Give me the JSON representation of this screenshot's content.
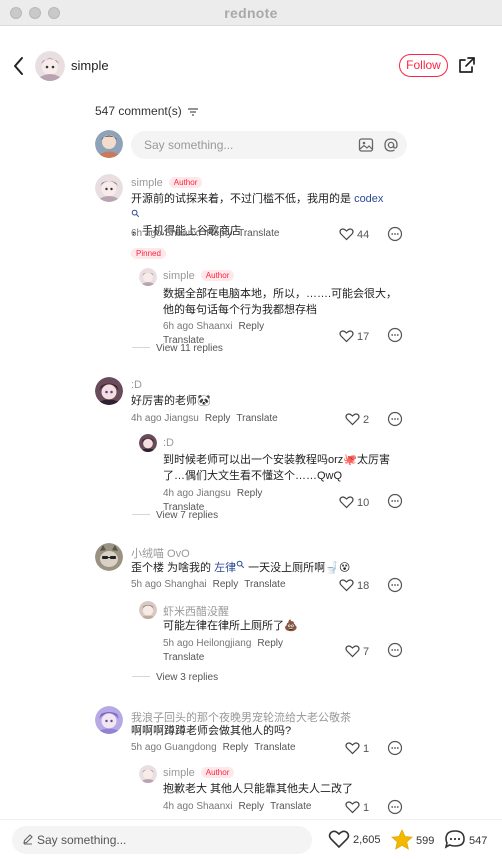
{
  "window": {
    "title": "rednote"
  },
  "header": {
    "author_name": "simple",
    "follow_label": "Follow"
  },
  "comments_header": {
    "count_label": "547 comment(s)"
  },
  "composer": {
    "placeholder": "Say something..."
  },
  "author_tag": "Author",
  "pinned_label": "Pinned",
  "reply_label": "Reply",
  "translate_label": "Translate",
  "threads": [
    {
      "name": "simple",
      "is_author": true,
      "pinned": true,
      "text_before": "开源前的试探来着，不过门槛不低，我用的是 ",
      "link": "codex",
      "text_after": "，手机得能上谷歌商店",
      "time": "6h ago Shaanxi",
      "likes": "44",
      "reply": {
        "name": "simple",
        "is_author": true,
        "text": "数据全部在电脑本地，所以，…….可能会很大，他的每句话每个行为我都想存档",
        "time": "6h ago Shaanxi",
        "likes": "17"
      },
      "view_replies": "View 11 replies"
    },
    {
      "name": ":D",
      "text": "好厉害的老师🐼",
      "time": "4h ago Jiangsu",
      "likes": "2",
      "reply": {
        "name": ":D",
        "text": "到时候老师可以出一个安装教程吗orz🐙太厉害了…偶们大文生看不懂这个……QwQ",
        "time": "4h ago Jiangsu",
        "likes": "10"
      },
      "view_replies": "View 7 replies"
    },
    {
      "name": "小绒喵 OvO",
      "text_before": "歪个楼 为啥我的 ",
      "link": "左律",
      "text_after": " 一天没上厕所啊🚽😵",
      "time": "5h ago Shanghai",
      "likes": "18",
      "reply": {
        "name": "虾米西醋没醒",
        "text": "可能左律在律所上厕所了💩",
        "time": "5h ago Heilongjiang",
        "likes": "7"
      },
      "view_replies": "View 3 replies"
    },
    {
      "name": "我浪子回头的那个夜晚男宠轮流给大老公敬茶",
      "text": "啊啊啊蹲蹲老师会做其他人的吗?",
      "time": "5h ago Guangdong",
      "likes": "1",
      "reply": {
        "name": "simple",
        "is_author": true,
        "text": "抱歉老大 其他人只能靠其他夫人二改了",
        "time": "4h ago Shaanxi",
        "likes": "1"
      }
    }
  ],
  "bottom_bar": {
    "placeholder": "Say something...",
    "likes": "2,605",
    "collects": "599",
    "comments": "547"
  },
  "colors": {
    "accent": "#ff2442",
    "link": "#2b4a93",
    "star": "#f5b800"
  }
}
